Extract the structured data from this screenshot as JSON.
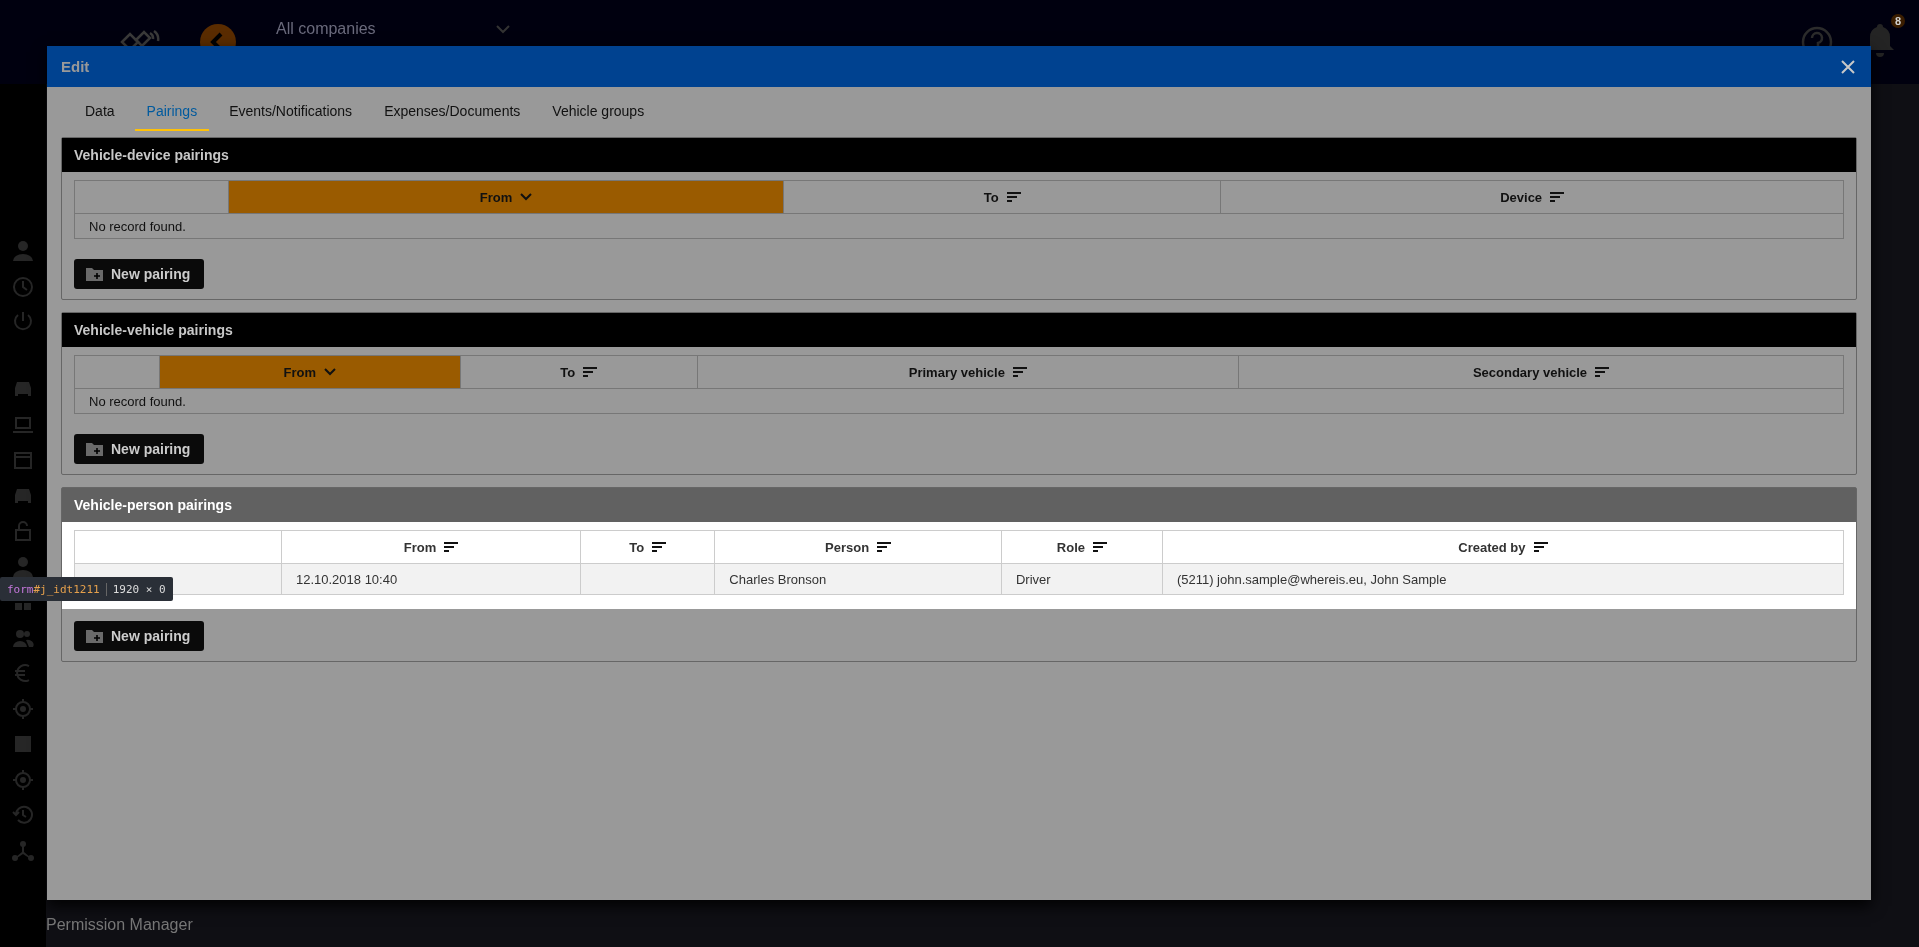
{
  "app": {
    "company_selector": "All companies",
    "notification_count": "8",
    "sidebar_footer": "Permission Manager"
  },
  "dialog": {
    "title": "Edit",
    "tabs": [
      {
        "label": "Data",
        "selected": false
      },
      {
        "label": "Pairings",
        "selected": true
      },
      {
        "label": "Events/Notifications",
        "selected": false
      },
      {
        "label": "Expenses/Documents",
        "selected": false
      },
      {
        "label": "Vehicle groups",
        "selected": false
      }
    ],
    "sections": [
      {
        "title": "Vehicle-device pairings",
        "highlighted": false,
        "columns": [
          {
            "kind": "select"
          },
          {
            "kind": "data",
            "label": "From",
            "sorted": true
          },
          {
            "kind": "data",
            "label": "To",
            "sorted": false
          },
          {
            "kind": "data",
            "label": "Device",
            "sorted": false
          }
        ],
        "empty_message": "No record found.",
        "button": "New pairing"
      },
      {
        "title": "Vehicle-vehicle pairings",
        "highlighted": false,
        "columns": [
          {
            "kind": "select"
          },
          {
            "kind": "data",
            "label": "From",
            "sorted": true
          },
          {
            "kind": "data",
            "label": "To",
            "sorted": false
          },
          {
            "kind": "data",
            "label": "Primary vehicle",
            "sorted": false
          },
          {
            "kind": "data",
            "label": "Secondary vehicle",
            "sorted": false
          }
        ],
        "empty_message": "No record found.",
        "button": "New pairing"
      },
      {
        "title": "Vehicle-person pairings",
        "highlighted": true,
        "columns": [
          {
            "kind": "select"
          },
          {
            "kind": "data",
            "label": "From",
            "sorted": false
          },
          {
            "kind": "data",
            "label": "To",
            "sorted": false
          },
          {
            "kind": "data",
            "label": "Person",
            "sorted": false
          },
          {
            "kind": "data",
            "label": "Role",
            "sorted": false
          },
          {
            "kind": "data",
            "label": "Created by",
            "sorted": false
          }
        ],
        "rows": [
          {
            "cells": [
              null,
              "12.10.2018 10:40",
              null,
              "Charles Bronson",
              "Driver",
              "(5211) john.sample@whereis.eu, John Sample"
            ]
          }
        ],
        "button": "New pairing"
      }
    ]
  },
  "devtools_tooltip": {
    "tag": "form",
    "id": "#j_idt1211",
    "size": "1920 × 0"
  }
}
